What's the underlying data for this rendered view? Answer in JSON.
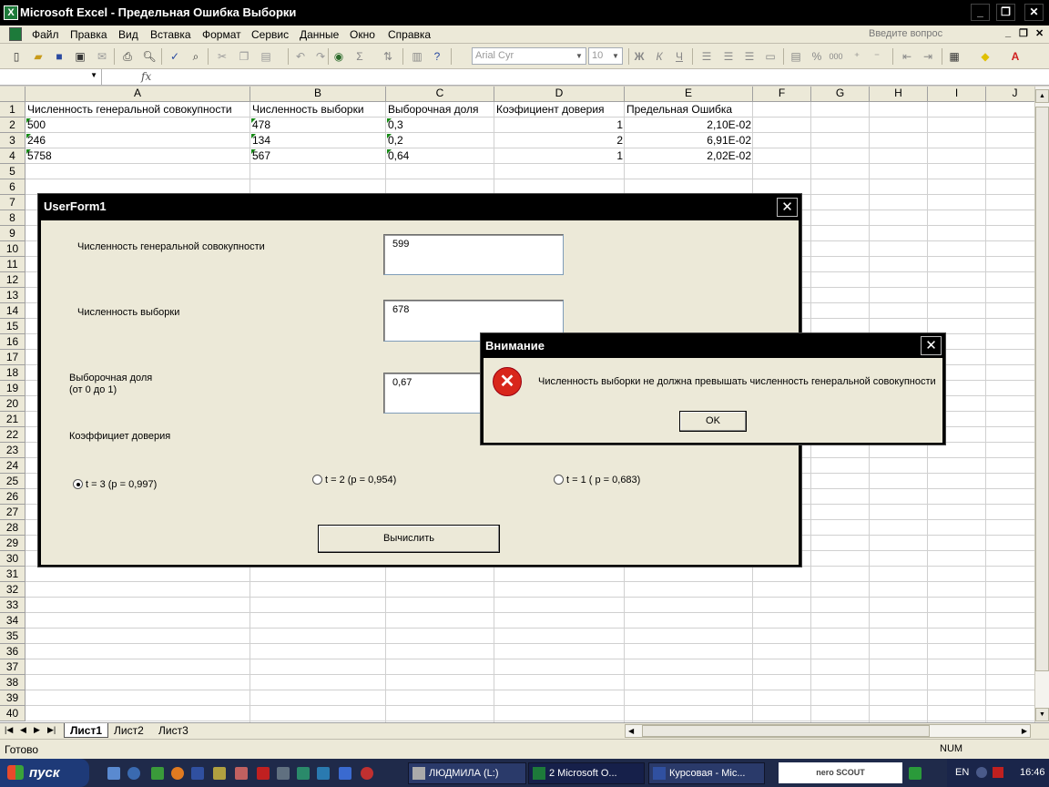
{
  "window": {
    "title": "Microsoft Excel - Предельная Ошибка Выборки",
    "minimize": "_",
    "restore": "❐",
    "close": "✕"
  },
  "menu": {
    "items": [
      "Файл",
      "Правка",
      "Вид",
      "Вставка",
      "Формат",
      "Сервис",
      "Данные",
      "Окно",
      "Справка"
    ],
    "help_placeholder": "Введите вопрос",
    "doc_min": "_",
    "doc_restore": "❐",
    "doc_close": "✕"
  },
  "toolbar": {
    "font_name": "Arial Cyr",
    "font_size": "10",
    "bold": "Ж",
    "italic": "К",
    "underline": "Ч",
    "percent": "%",
    "thousands": "000"
  },
  "formula": {
    "name_box": "",
    "fx": "fx",
    "content": ""
  },
  "grid": {
    "columns": [
      "A",
      "B",
      "C",
      "D",
      "E",
      "F",
      "G",
      "H",
      "I",
      "J"
    ],
    "rows": [
      "1",
      "2",
      "3",
      "4",
      "5",
      "6",
      "7",
      "8",
      "9",
      "10",
      "11",
      "12",
      "13",
      "14",
      "15",
      "16",
      "17",
      "18",
      "19",
      "20",
      "21",
      "22",
      "23",
      "24",
      "25",
      "26",
      "27",
      "28",
      "29",
      "30",
      "31",
      "32",
      "33",
      "34",
      "35",
      "36",
      "37",
      "38",
      "39",
      "40"
    ],
    "header": [
      "Численность генеральной совокупности",
      "Численность выборки",
      "Выборочная доля",
      "Коэфициент доверия",
      "Предельная Ошибка"
    ],
    "data": [
      [
        "500",
        "478",
        "0,3",
        "1",
        "2,10E-02"
      ],
      [
        "246",
        "134",
        "0,2",
        "2",
        "6,91E-02"
      ],
      [
        "5758",
        "567",
        "0,64",
        "1",
        "2,02E-02"
      ]
    ]
  },
  "sheets": {
    "tabs": [
      "Лист1",
      "Лист2",
      "Лист3"
    ],
    "active": "Лист1"
  },
  "status": {
    "ready": "Готово",
    "num": "NUM"
  },
  "userform": {
    "title": "UserForm1",
    "close": "✕",
    "label_population": "Численность генеральной совокупности",
    "value_population": "599",
    "label_sample": "Численность выборки",
    "value_sample": "678",
    "label_share_1": "Выборочная доля",
    "label_share_2": "(от 0 до 1)",
    "value_share": "0,67",
    "label_confidence": "Коэффициет доверия",
    "radio_1": "t = 3 (p = 0,997)",
    "radio_2": "t = 2 (p = 0,954)",
    "radio_3": "t = 1 ( p = 0,683)",
    "selected_radio": "t = 3 (p = 0,997)",
    "calculate": "Вычислить"
  },
  "messagebox": {
    "title": "Внимание",
    "close": "✕",
    "icon": "✕",
    "message": "Численность выборки не должна превышать численность генеральной совокупности",
    "ok": "OK"
  },
  "taskbar": {
    "start": "пуск",
    "tasks": [
      "ЛЮДМИЛА (L:)",
      "2 Microsoft O...",
      "Курсовая - Mic..."
    ],
    "nero": "nero SCOUT",
    "lang": "EN",
    "clock": "16:46"
  }
}
